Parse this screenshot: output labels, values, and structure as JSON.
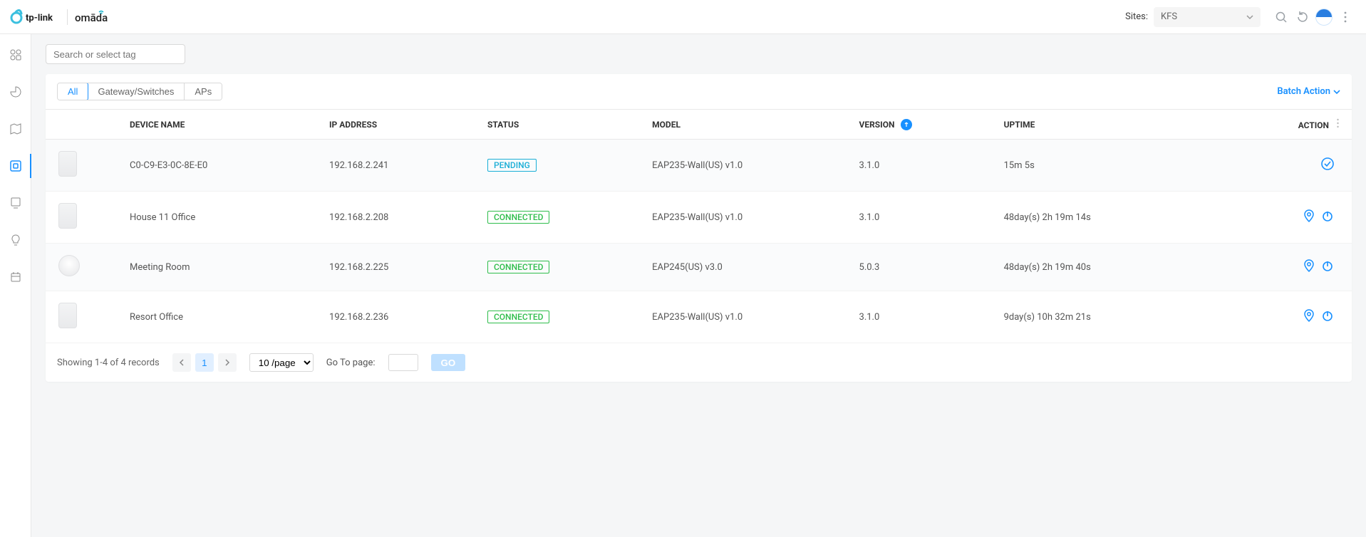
{
  "header": {
    "brand1": "tp-link",
    "brand2": "omāda",
    "sites_label": "Sites:",
    "site_selected": "KFS"
  },
  "search": {
    "placeholder": "Search or select tag"
  },
  "tabs": {
    "all": "All",
    "gs": "Gateway/Switches",
    "aps": "APs"
  },
  "batch_action": "Batch Action",
  "columns": {
    "device_name": "DEVICE NAME",
    "ip": "IP ADDRESS",
    "status": "STATUS",
    "model": "MODEL",
    "version": "VERSION",
    "uptime": "UPTIME",
    "action": "ACTION"
  },
  "status_labels": {
    "PENDING": "PENDING",
    "CONNECTED": "CONNECTED"
  },
  "rows": [
    {
      "icon": "wall",
      "name": "C0-C9-E3-0C-8E-E0",
      "ip": "192.168.2.241",
      "status": "PENDING",
      "model": "EAP235-Wall(US) v1.0",
      "version": "3.1.0",
      "uptime": "15m 5s",
      "actions": [
        "adopt"
      ]
    },
    {
      "icon": "wall",
      "name": "House 11 Office",
      "ip": "192.168.2.208",
      "status": "CONNECTED",
      "model": "EAP235-Wall(US) v1.0",
      "version": "3.1.0",
      "uptime": "48day(s) 2h 19m 14s",
      "actions": [
        "locate",
        "reboot"
      ]
    },
    {
      "icon": "round",
      "name": "Meeting Room",
      "ip": "192.168.2.225",
      "status": "CONNECTED",
      "model": "EAP245(US) v3.0",
      "version": "5.0.3",
      "uptime": "48day(s) 2h 19m 40s",
      "actions": [
        "locate",
        "reboot"
      ]
    },
    {
      "icon": "wall",
      "name": "Resort Office",
      "ip": "192.168.2.236",
      "status": "CONNECTED",
      "model": "EAP235-Wall(US) v1.0",
      "version": "3.1.0",
      "uptime": "9day(s) 10h 32m 21s",
      "actions": [
        "locate",
        "reboot"
      ]
    }
  ],
  "footer": {
    "info": "Showing 1-4 of 4 records",
    "page": "1",
    "per_page": "10 /page",
    "goto_label": "Go To page:",
    "go": "GO"
  }
}
